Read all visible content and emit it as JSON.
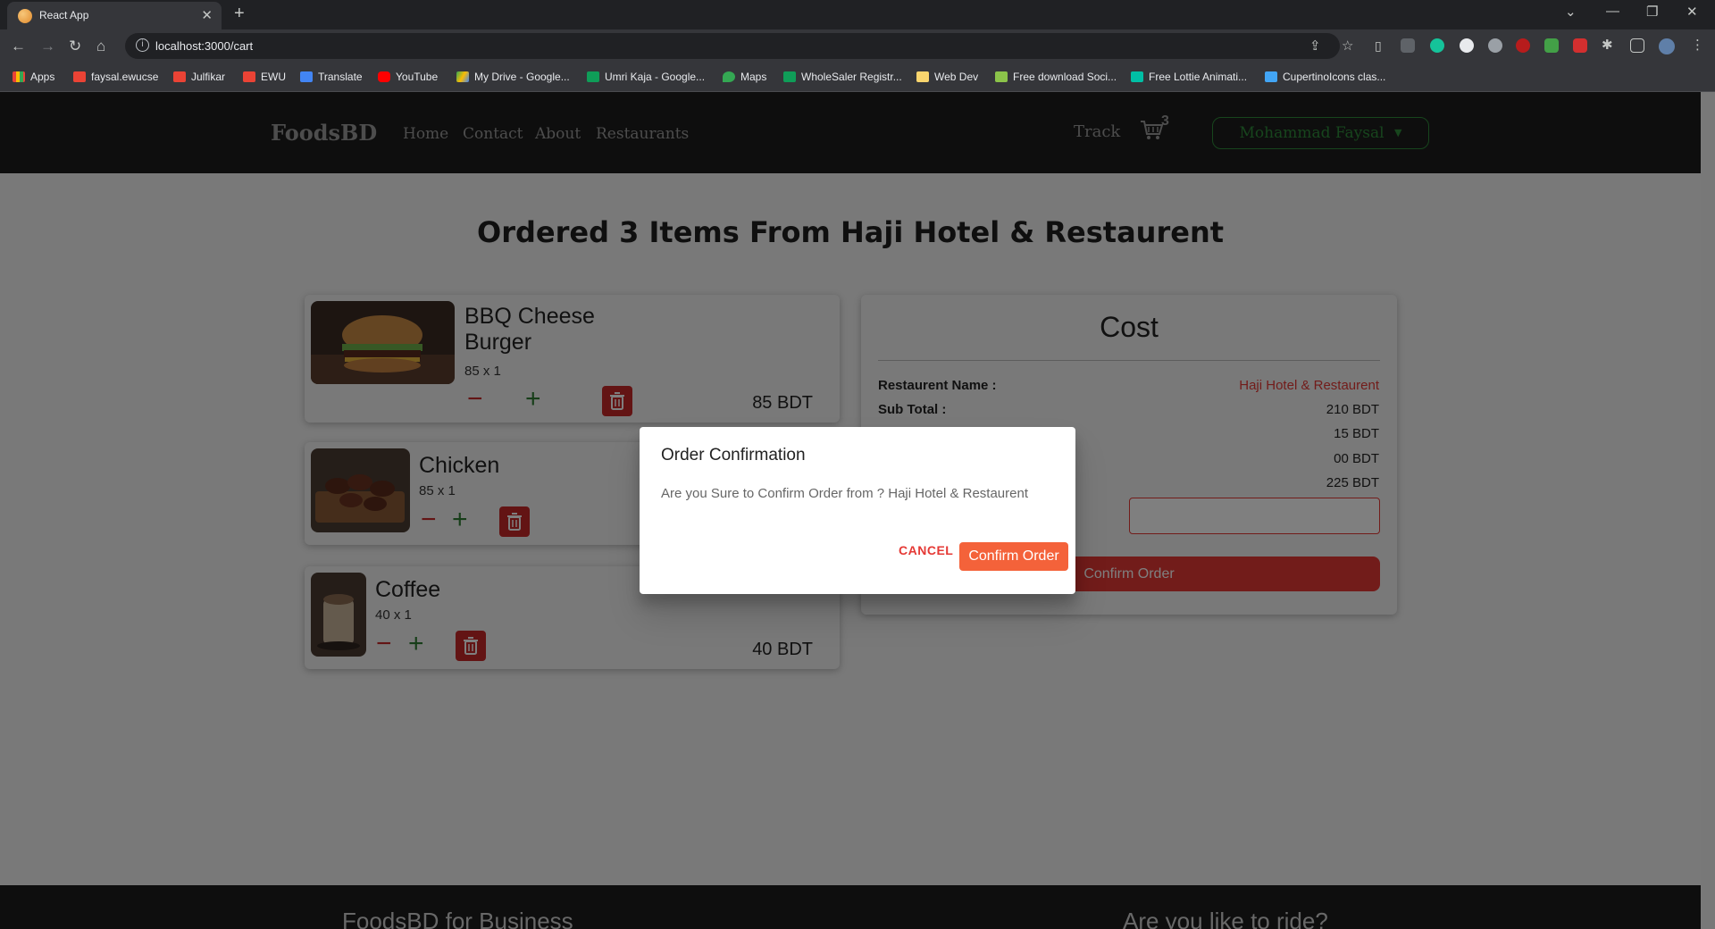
{
  "browser": {
    "tab_title": "React App",
    "url": "localhost:3000/cart",
    "bookmarks": [
      "Apps",
      "faysal.ewucse",
      "Julfikar",
      "EWU",
      "Translate",
      "YouTube",
      "My Drive - Google...",
      "Umri Kaja - Google...",
      "Maps",
      "WholeSaler Registr...",
      "Web Dev",
      "Free download Soci...",
      "Free Lottie Animati...",
      "CupertinoIcons clas..."
    ]
  },
  "navbar": {
    "brand": "FoodsBD",
    "links": [
      "Home",
      "Contact",
      "About",
      "Restaurants"
    ],
    "track": "Track",
    "cart_count": "3",
    "user": "Mohammad Faysal"
  },
  "page_title": "Ordered 3 Items From Haji Hotel & Restaurent",
  "items": [
    {
      "name_line1": "BBQ Cheese",
      "name_line2": "Burger",
      "qty": "85 x 1",
      "price": "85 BDT",
      "image": "burger"
    },
    {
      "name_line1": "Chicken",
      "qty": "85 x 1",
      "image": "chicken-skewers"
    },
    {
      "name_line1": "Coffee",
      "qty": "40 x 1",
      "price": "40 BDT",
      "image": "coffee"
    }
  ],
  "cost": {
    "title": "Cost",
    "restaurant_label": "Restaurent Name :",
    "restaurant_value": "Haji Hotel & Restaurent",
    "subtotal_label": "Sub Total :",
    "subtotal_value": "210 BDT",
    "row3_value": "15 BDT",
    "row4_value": "00 BDT",
    "row5_value": "225 BDT",
    "confirm_label": "Confirm Order"
  },
  "footer": {
    "left_heading": "FoodsBD for Business",
    "right_heading": "Are you like to ride?"
  },
  "modal": {
    "title": "Order Confirmation",
    "text": "Are you Sure to Confirm Order from ? Haji Hotel & Restaurent",
    "cancel": "CANCEL",
    "confirm": "Confirm Order"
  },
  "colors": {
    "accent_red": "#e53935",
    "brand_green": "#2e8b3a",
    "navbar_bg": "#1c1c1c"
  }
}
